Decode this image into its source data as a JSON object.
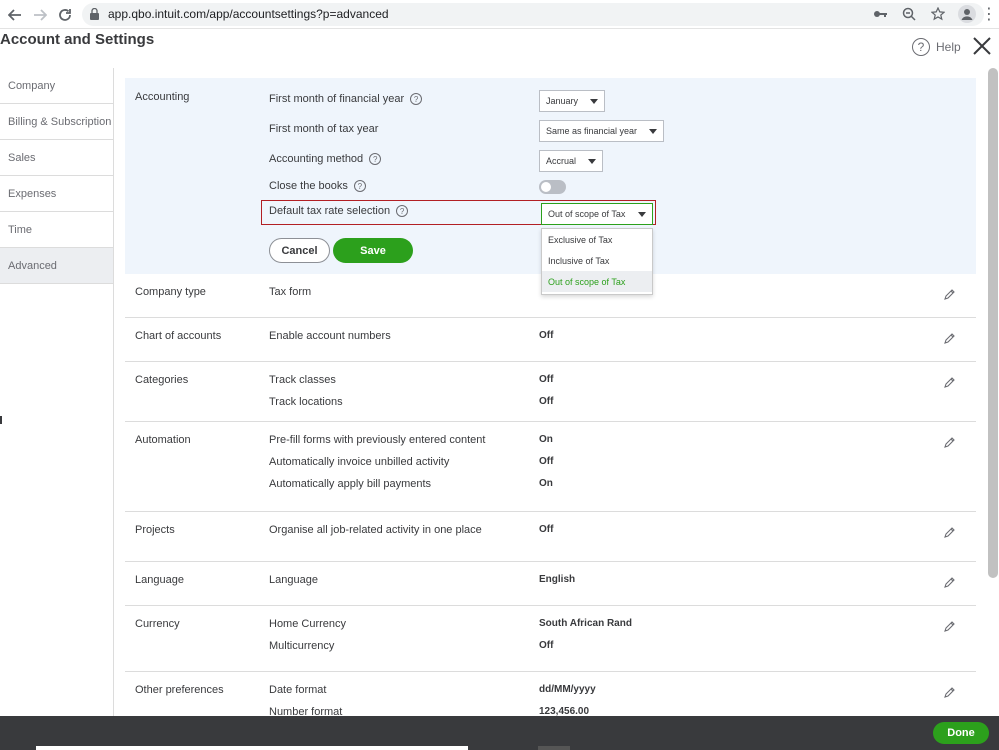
{
  "browser": {
    "url": "app.qbo.intuit.com/app/accountsettings?p=advanced"
  },
  "header": {
    "title": "Account and Settings",
    "help_label": "Help"
  },
  "sidebar": {
    "items": [
      {
        "label": "Company"
      },
      {
        "label": "Billing & Subscription"
      },
      {
        "label": "Sales"
      },
      {
        "label": "Expenses"
      },
      {
        "label": "Time"
      },
      {
        "label": "Advanced",
        "active": true
      }
    ]
  },
  "accounting": {
    "title": "Accounting",
    "first_month_label": "First month of financial year",
    "first_month_value": "January",
    "tax_year_label": "First month of tax year",
    "tax_year_value": "Same as financial year",
    "method_label": "Accounting method",
    "method_value": "Accrual",
    "close_books_label": "Close the books",
    "close_books_on": false,
    "tax_rate_label": "Default tax rate selection",
    "tax_rate_value": "Out of scope of Tax",
    "tax_rate_options": [
      "Exclusive of Tax",
      "Inclusive of Tax",
      "Out of scope of Tax"
    ],
    "cancel_label": "Cancel",
    "save_label": "Save"
  },
  "sections": {
    "company_type": {
      "title": "Company type",
      "tax_form_label": "Tax form"
    },
    "chart_of_accounts": {
      "title": "Chart of accounts",
      "enable_numbers_label": "Enable account numbers",
      "enable_numbers_value": "Off"
    },
    "categories": {
      "title": "Categories",
      "track_classes_label": "Track classes",
      "track_classes_value": "Off",
      "track_locations_label": "Track locations",
      "track_locations_value": "Off"
    },
    "automation": {
      "title": "Automation",
      "prefill_label": "Pre-fill forms with previously entered content",
      "prefill_value": "On",
      "invoice_label": "Automatically invoice unbilled activity",
      "invoice_value": "Off",
      "bill_label": "Automatically apply bill payments",
      "bill_value": "On"
    },
    "projects": {
      "title": "Projects",
      "organise_label": "Organise all job-related activity in one place",
      "organise_value": "Off"
    },
    "language": {
      "title": "Language",
      "language_label": "Language",
      "language_value": "English"
    },
    "currency": {
      "title": "Currency",
      "home_label": "Home Currency",
      "home_value": "South African Rand",
      "multi_label": "Multicurrency",
      "multi_value": "Off"
    },
    "other": {
      "title": "Other preferences",
      "date_format_label": "Date format",
      "date_format_value": "dd/MM/yyyy",
      "number_format_label": "Number format",
      "number_format_value": "123,456.00"
    }
  },
  "footer": {
    "done_label": "Done"
  },
  "colors": {
    "accent": "#2ca01c",
    "highlight": "#b21f24",
    "section_bg": "#eff5fc"
  }
}
